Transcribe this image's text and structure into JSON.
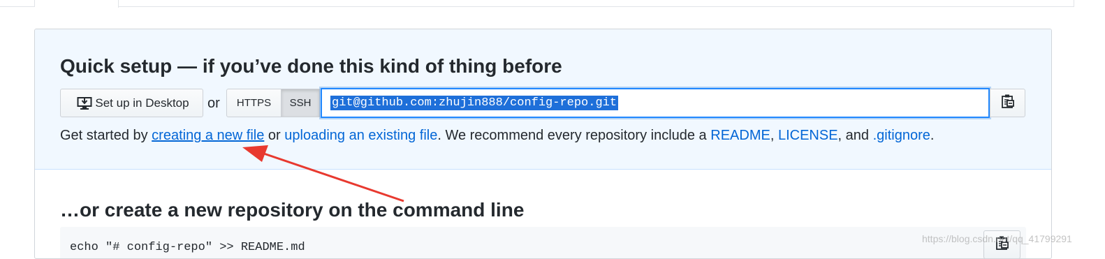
{
  "quick_setup": {
    "title": "Quick setup — if you’ve done this kind of thing before",
    "desktop_button": "Set up in Desktop",
    "or": "or",
    "https_tab": "HTTPS",
    "ssh_tab": "SSH",
    "clone_url": "git@github.com:zhujin888/config-repo.git",
    "getstarted": {
      "prefix": "Get started by ",
      "link_new_file": "creating a new file",
      "mid1": " or ",
      "link_upload": "uploading an existing file",
      "mid2": ". We recommend every repository include a ",
      "link_readme": "README",
      "comma": ", ",
      "link_license": "LICENSE",
      "and": ", and ",
      "link_gitignore": ".gitignore",
      "end": "."
    }
  },
  "command_line": {
    "title": "…or create a new repository on the command line",
    "code": "echo \"# config-repo\" >> README.md"
  },
  "watermark": "https://blog.csdn.net/qq_41799291",
  "colors": {
    "accent": "#0366d6",
    "annotation_arrow": "#e8392f",
    "panel_bg": "#f1f8ff"
  },
  "icons": {
    "desktop": "desktop-download-icon",
    "clipboard": "clipboard-icon"
  }
}
